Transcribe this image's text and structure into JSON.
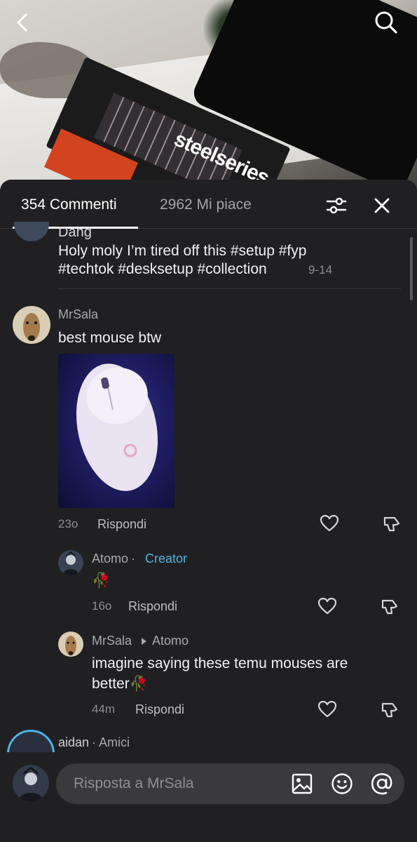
{
  "video": {
    "brand_text": "steelseries"
  },
  "tabs": {
    "comments": "354 Commenti",
    "likes": "2962 Mi piace"
  },
  "comments": [
    {
      "author": "Dang",
      "text_line1": "Holy moly I’m tired off this #setup #fyp",
      "text_line2": "#techtok #desksetup #collection",
      "time": "9-14"
    },
    {
      "author": "MrSala",
      "text": "best mouse btw",
      "time": "23o",
      "reply_label": "Rispondi"
    }
  ],
  "replies": [
    {
      "author": "Atomo",
      "separator": " · ",
      "badge": "Creator",
      "text": "🥀",
      "time": "16o",
      "reply_label": "Rispondi"
    },
    {
      "author": "MrSala",
      "reply_to": "Atomo",
      "text_line1": "imagine saying these temu mouses are",
      "text_line2": "better🥀",
      "time": "44m",
      "reply_label": "Rispondi"
    }
  ],
  "next_comment": {
    "author": "aidan",
    "relation": " · Amici"
  },
  "input": {
    "placeholder": "Risposta a MrSala"
  },
  "colors": {
    "sheet_bg": "#202022",
    "creator_badge": "#4fb2e6",
    "input_bg": "#3a3a3d"
  },
  "icons": [
    "back-icon",
    "search-icon",
    "filter-icon",
    "close-icon",
    "heart-icon",
    "dislike-icon",
    "image-icon",
    "emoji-icon",
    "mention-icon"
  ]
}
